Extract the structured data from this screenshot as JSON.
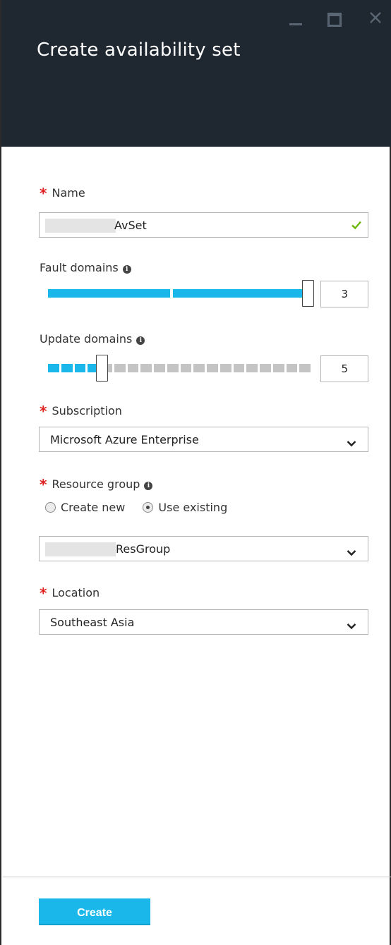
{
  "window": {
    "title": "Create availability set"
  },
  "name_field": {
    "label": "Name",
    "value": "AvSet"
  },
  "fault_domains": {
    "label": "Fault domains",
    "value": "3",
    "fraction": 1.0
  },
  "update_domains": {
    "label": "Update domains",
    "value": "5",
    "segments_total": 20,
    "segments_filled": 4
  },
  "subscription": {
    "label": "Subscription",
    "selected": "Microsoft Azure Enterprise"
  },
  "resource_group": {
    "label": "Resource group",
    "options": [
      "Create new",
      "Use existing"
    ],
    "selected_option": "Use existing",
    "selected": "ResGroup"
  },
  "location": {
    "label": "Location",
    "selected": "Southeast Asia"
  },
  "footer": {
    "create_label": "Create"
  },
  "colors": {
    "accent": "#1ab8ea",
    "required": "#e0201f",
    "valid": "#6bb700",
    "header_bg": "#1f2730"
  },
  "icons": [
    "minimize-icon",
    "maximize-icon",
    "close-icon",
    "check-icon",
    "info-icon",
    "chevron-down-icon"
  ]
}
